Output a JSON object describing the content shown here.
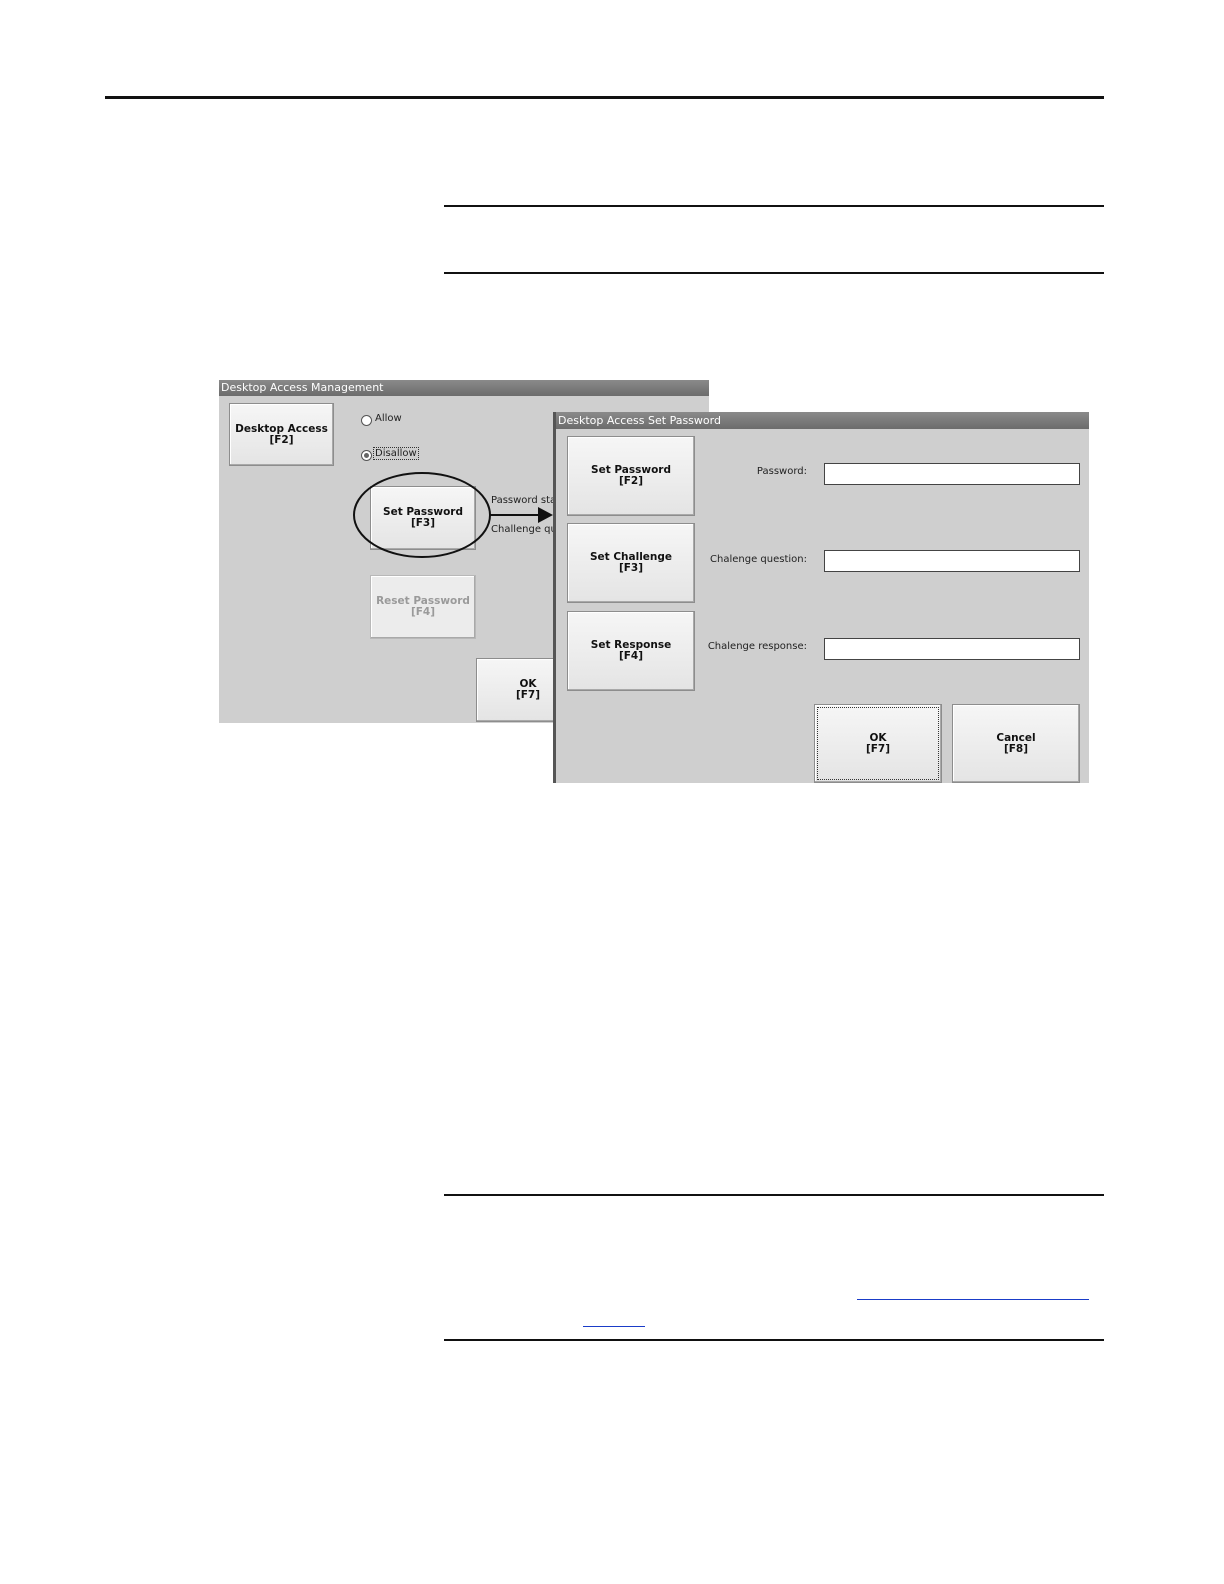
{
  "back_window": {
    "title": "Desktop Access Management",
    "desktop_access_btn": {
      "line1": "Desktop Access",
      "line2": "[F2]"
    },
    "allow_label": "Allow",
    "disallow_label": "Disallow",
    "access_selected": "Disallow",
    "set_password_btn": {
      "line1": "Set Password",
      "line2": "[F3]"
    },
    "reset_password_btn": {
      "line1": "Reset Password",
      "line2": "[F4]"
    },
    "ok_btn": {
      "line1": "OK",
      "line2": "[F7]"
    },
    "password_status_label": "Password statu",
    "challenge_question_label": "Challenge que"
  },
  "front_window": {
    "title": "Desktop Access Set Password",
    "set_password_btn": {
      "line1": "Set Password",
      "line2": "[F2]"
    },
    "set_challenge_btn": {
      "line1": "Set Challenge",
      "line2": "[F3]"
    },
    "set_response_btn": {
      "line1": "Set Response",
      "line2": "[F4]"
    },
    "password_label": "Password:",
    "password_value": "",
    "challenge_question_label": "Chalenge question:",
    "challenge_question_value": "",
    "challenge_response_label": "Chalenge response:",
    "challenge_response_value": "",
    "ok_btn": {
      "line1": "OK",
      "line2": "[F7]"
    },
    "cancel_btn": {
      "line1": "Cancel",
      "line2": "[F8]"
    }
  },
  "colors": {
    "panel_bg": "#cfcfcf",
    "titlebar": "#6c6c6c",
    "link": "#1a3cc8"
  },
  "callout": {
    "shape": "ellipse",
    "target": "set-password-button",
    "arrow_to": "front-window"
  }
}
